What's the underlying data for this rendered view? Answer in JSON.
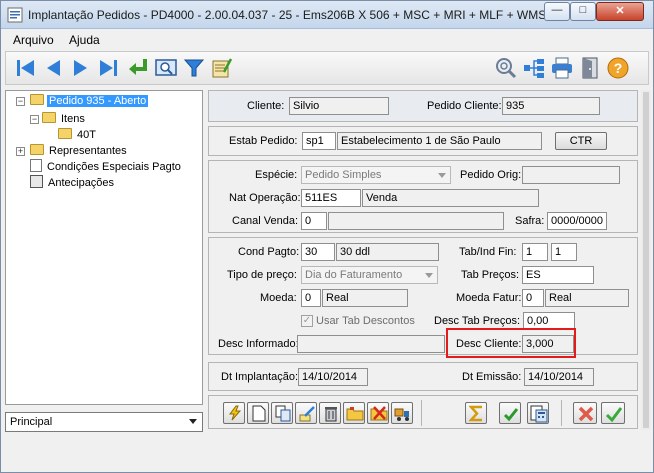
{
  "window": {
    "title": "Implantação Pedidos - PD4000 - 2.00.04.037 - 25 - Ems206B X 506 + MSC + MRI + MLF + WMS",
    "minimize_glyph": "—",
    "maximize_glyph": "□",
    "close_glyph": "✕"
  },
  "menu": {
    "file_label": "Arquivo",
    "help_label": "Ajuda"
  },
  "tree": {
    "root_label": "Pedido 935 - Aberto",
    "items_label": "Itens",
    "item_label": "40T",
    "reps_label": "Representantes",
    "conditions_label": "Condições Especiais Pagto",
    "advances_label": "Antecipações",
    "expander_minus": "−",
    "expander_plus": "+"
  },
  "view_select": {
    "value": "Principal"
  },
  "header": {
    "client_label": "Cliente:",
    "client_value": "Silvio",
    "order_client_label": "Pedido Cliente:",
    "order_client_value": "935"
  },
  "estab": {
    "label": "Estab Pedido:",
    "code": "sp1",
    "name": "Estabelecimento 1 de São Paulo",
    "ctr_label": "CTR"
  },
  "species": {
    "label": "Espécie:",
    "value": "Pedido Simples",
    "orig_label": "Pedido Orig:",
    "orig_value": "",
    "nat_label": "Nat Operação:",
    "nat_code": "511ES",
    "nat_name": "Venda",
    "channel_label": "Canal Venda:",
    "channel_code": "0",
    "channel_name": "",
    "harvest_label": "Safra:",
    "harvest_value": "0000/0000"
  },
  "payment": {
    "cond_label": "Cond Pagto:",
    "cond_code": "30",
    "cond_name": "30 ddl",
    "tabind_label": "Tab/Ind Fin:",
    "tabind_a": "1",
    "tabind_b": "1",
    "price_type_label": "Tipo de preço:",
    "price_type_value": "Dia do Faturamento",
    "price_tables_label": "Tab Preços:",
    "price_tables_value": "ES",
    "currency_label": "Moeda:",
    "currency_code": "0",
    "currency_name": "Real",
    "billing_currency_label": "Moeda Fatur:",
    "billing_currency_code": "0",
    "billing_currency_name": "Real",
    "use_discounts_label": "Usar Tab Descontos",
    "use_discounts_check": "✓",
    "desc_tab_label": "Desc Tab Preços:",
    "desc_tab_value": "0,00",
    "desc_informed_label": "Desc Informado:",
    "desc_informed_value": "",
    "desc_client_label": "Desc Cliente:",
    "desc_client_value": "3,000"
  },
  "dates": {
    "impl_label": "Dt Implantação:",
    "impl_value": "14/10/2014",
    "issue_label": "Dt Emissão:",
    "issue_value": "14/10/2014"
  },
  "colors": {
    "selection": "#3399ff",
    "highlight": "#e31b1b",
    "nav_blue": "#2f7fd9"
  }
}
